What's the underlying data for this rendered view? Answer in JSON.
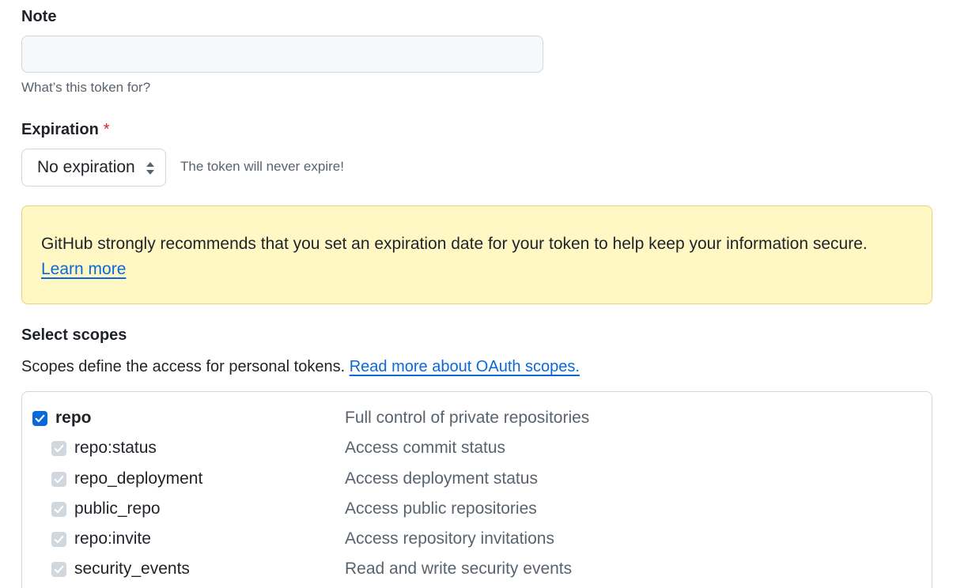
{
  "note": {
    "label": "Note",
    "value": "",
    "placeholder": "",
    "hint": "What’s this token for?"
  },
  "expiration": {
    "label": "Expiration",
    "required_mark": "*",
    "selected": "No expiration",
    "hint": "The token will never expire!"
  },
  "flash": {
    "message": "GitHub strongly recommends that you set an expiration date for your token to help keep your information secure.",
    "link": "Learn more"
  },
  "scopes": {
    "heading": "Select scopes",
    "description": "Scopes define the access for personal tokens.",
    "link": "Read more about OAuth scopes.",
    "parent": {
      "name": "repo",
      "description": "Full control of private repositories",
      "checked": true
    },
    "children": [
      {
        "name": "repo:status",
        "description": "Access commit status",
        "checked": true
      },
      {
        "name": "repo_deployment",
        "description": "Access deployment status",
        "checked": true
      },
      {
        "name": "public_repo",
        "description": "Access public repositories",
        "checked": true
      },
      {
        "name": "repo:invite",
        "description": "Access repository invitations",
        "checked": true
      },
      {
        "name": "security_events",
        "description": "Read and write security events",
        "checked": true
      }
    ]
  },
  "colors": {
    "accent": "#0969da",
    "flash_bg": "#fff8c5",
    "required": "#cf222e"
  }
}
